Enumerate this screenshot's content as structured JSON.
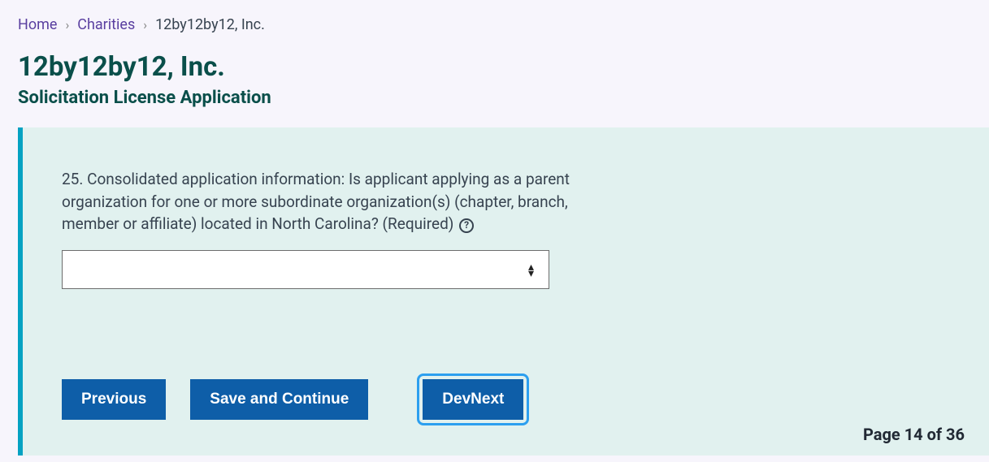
{
  "breadcrumb": {
    "home": "Home",
    "charities": "Charities",
    "current": "12by12by12, Inc."
  },
  "header": {
    "title": "12by12by12, Inc.",
    "subtitle": "Solicitation License Application"
  },
  "form": {
    "question": "25. Consolidated application information: Is applicant applying as a parent organization for one or more subordinate organization(s) (chapter, branch, member or affiliate) located in North Carolina? (Required)",
    "help_symbol": "?",
    "select_value": ""
  },
  "buttons": {
    "previous": "Previous",
    "save_continue": "Save and Continue",
    "dev_next": "DevNext"
  },
  "pagination": {
    "label": "Page 14 of 36"
  }
}
